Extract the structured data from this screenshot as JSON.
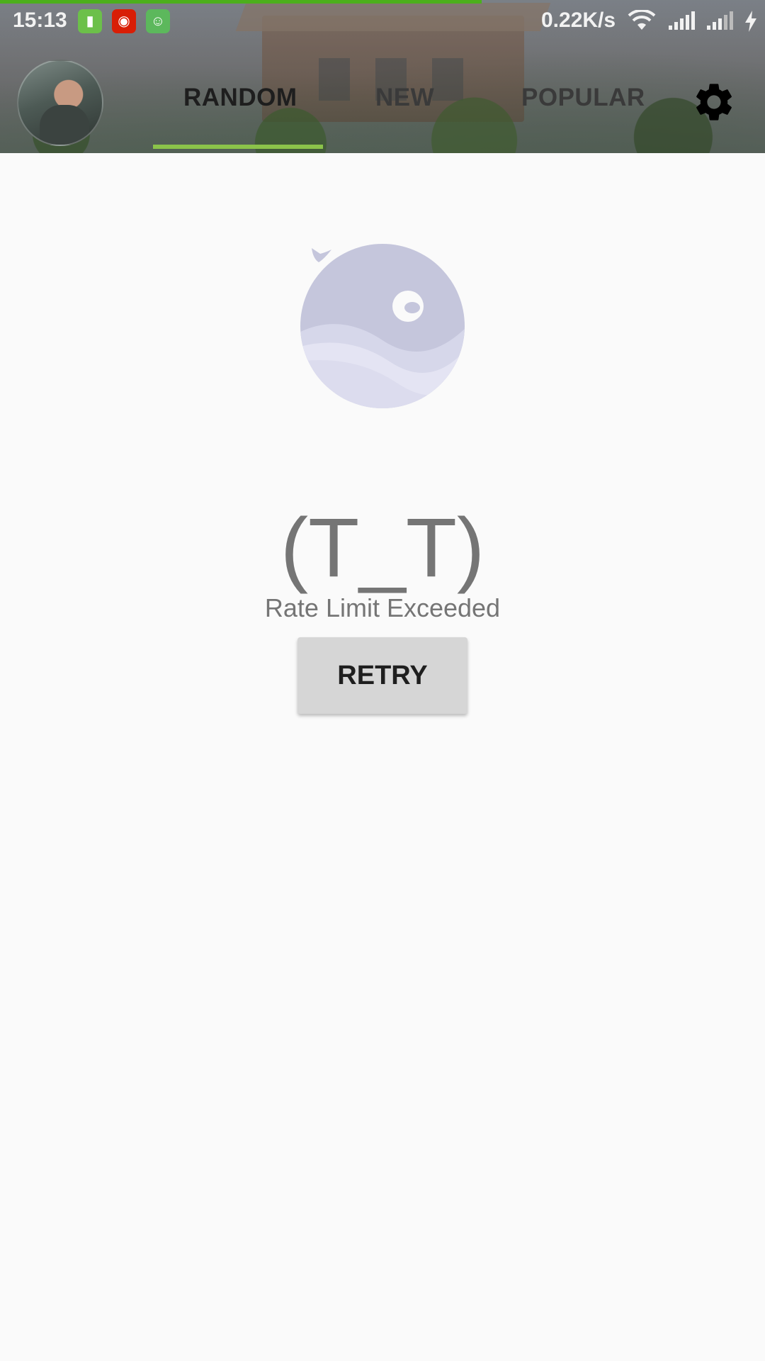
{
  "status_bar": {
    "time": "15:13",
    "net_speed": "0.22K/s",
    "icons": [
      "battery-saver-app-icon",
      "netease-music-app-icon",
      "android-app-icon",
      "wifi-icon",
      "signal-icon",
      "signal-icon",
      "charging-icon"
    ],
    "loading_progress": 0.63
  },
  "header": {
    "tabs": [
      {
        "label": "RANDOM",
        "selected": true
      },
      {
        "label": "NEW",
        "selected": false
      },
      {
        "label": "POPULAR",
        "selected": false
      }
    ],
    "settings_icon": "gear-icon",
    "indicator_color": "#8bc34a"
  },
  "content": {
    "illustration": "whale-icon",
    "emoticon": "(T_T)",
    "message": "Rate Limit Exceeded",
    "retry_label": "RETRY"
  },
  "colors": {
    "background": "#fafafa",
    "text_muted": "#757575",
    "button": "#d6d6d6",
    "whale": "#c5c6dc"
  }
}
